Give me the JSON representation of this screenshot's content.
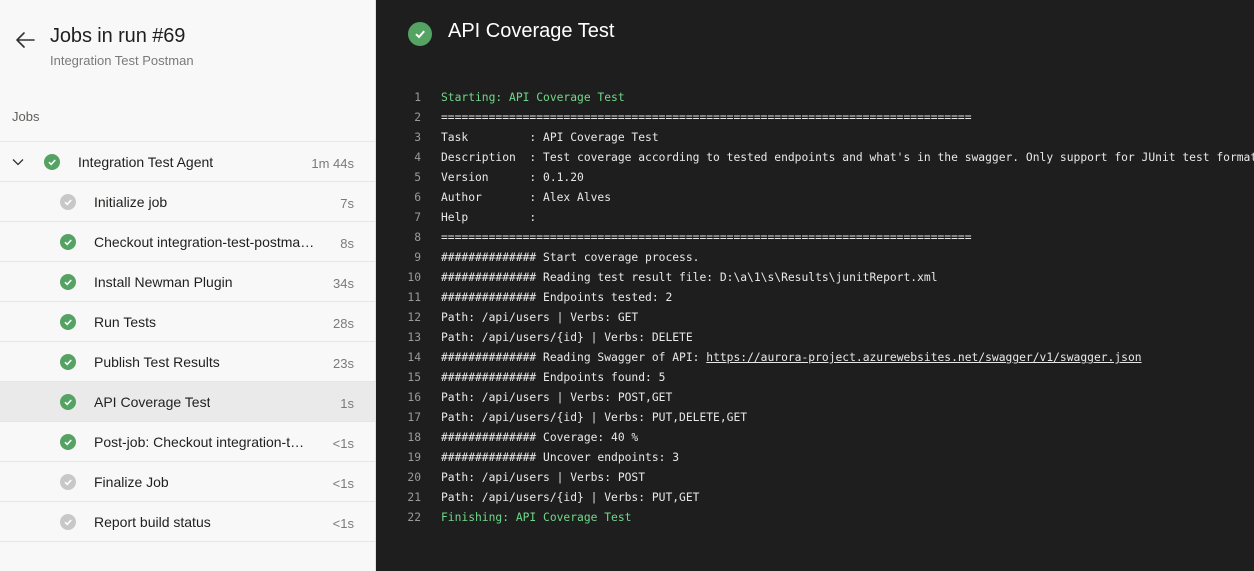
{
  "run": {
    "title": "Jobs in run #69",
    "subtitle": "Integration Test Postman"
  },
  "sidebar": {
    "section_label": "Jobs",
    "agent": {
      "label": "Integration Test Agent",
      "duration": "1m 44s"
    },
    "steps": [
      {
        "label": "Initialize job",
        "duration": "7s",
        "status": "pending"
      },
      {
        "label": "Checkout integration-test-postma…",
        "duration": "8s",
        "status": "success"
      },
      {
        "label": "Install Newman Plugin",
        "duration": "34s",
        "status": "success"
      },
      {
        "label": "Run Tests",
        "duration": "28s",
        "status": "success"
      },
      {
        "label": "Publish Test Results",
        "duration": "23s",
        "status": "success"
      },
      {
        "label": "API Coverage Test",
        "duration": "1s",
        "status": "success",
        "selected": true
      },
      {
        "label": "Post-job: Checkout integration-t…",
        "duration": "<1s",
        "status": "success"
      },
      {
        "label": "Finalize Job",
        "duration": "<1s",
        "status": "pending"
      },
      {
        "label": "Report build status",
        "duration": "<1s",
        "status": "pending"
      }
    ]
  },
  "main": {
    "title": "API Coverage Test",
    "log": [
      {
        "n": "1",
        "text": "Starting: API Coverage Test",
        "green": true
      },
      {
        "n": "2",
        "text": "=============================================================================="
      },
      {
        "n": "3",
        "text": "Task         : API Coverage Test"
      },
      {
        "n": "4",
        "text": "Description  : Test coverage according to tested endpoints and what's in the swagger. Only support for JUnit test format."
      },
      {
        "n": "5",
        "text": "Version      : 0.1.20"
      },
      {
        "n": "6",
        "text": "Author       : Alex Alves"
      },
      {
        "n": "7",
        "text": "Help         :"
      },
      {
        "n": "8",
        "text": "=============================================================================="
      },
      {
        "n": "9",
        "text": "############## Start coverage process."
      },
      {
        "n": "10",
        "text": "############## Reading test result file: D:\\a\\1\\s\\Results\\junitReport.xml"
      },
      {
        "n": "11",
        "text": "############## Endpoints tested: 2"
      },
      {
        "n": "12",
        "text": "Path: /api/users | Verbs: GET"
      },
      {
        "n": "13",
        "text": "Path: /api/users/{id} | Verbs: DELETE"
      },
      {
        "n": "14",
        "text": "############## Reading Swagger of API: ",
        "link": "https://aurora-project.azurewebsites.net/swagger/v1/swagger.json"
      },
      {
        "n": "15",
        "text": "############## Endpoints found: 5"
      },
      {
        "n": "16",
        "text": "Path: /api/users | Verbs: POST,GET"
      },
      {
        "n": "17",
        "text": "Path: /api/users/{id} | Verbs: PUT,DELETE,GET"
      },
      {
        "n": "18",
        "text": "############## Coverage: 40 %"
      },
      {
        "n": "19",
        "text": "############## Uncover endpoints: 3"
      },
      {
        "n": "20",
        "text": "Path: /api/users | Verbs: POST"
      },
      {
        "n": "21",
        "text": "Path: /api/users/{id} | Verbs: PUT,GET"
      },
      {
        "n": "22",
        "text": "Finishing: API Coverage Test",
        "green": true
      }
    ]
  },
  "colors": {
    "success": "#55a362",
    "pending": "#c8c8c8",
    "log_bg": "#1e1e1e",
    "log_green": "#71d78a"
  },
  "icons": {
    "back": "arrow-left-icon",
    "expand": "chevron-down-icon",
    "success": "check-circle-icon",
    "pending": "check-circle-icon"
  }
}
